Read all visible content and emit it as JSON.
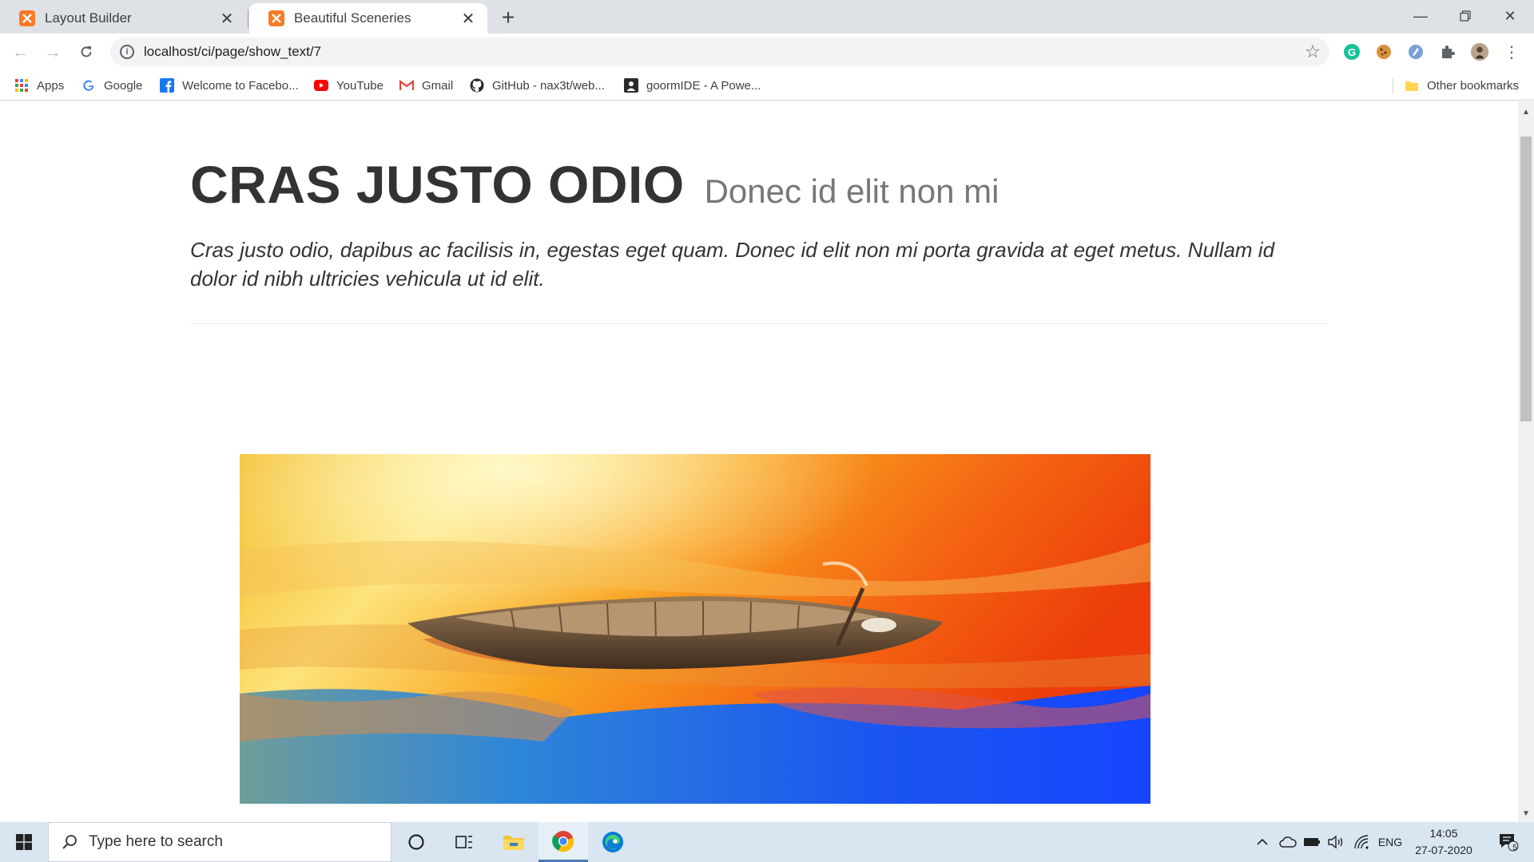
{
  "browser": {
    "tabs": [
      {
        "title": "Layout Builder",
        "active": false
      },
      {
        "title": "Beautiful Sceneries",
        "active": true
      }
    ],
    "url": "localhost/ci/page/show_text/7",
    "bookmarks": [
      {
        "label": "Apps",
        "icon": "apps-grid-icon"
      },
      {
        "label": "Google",
        "icon": "google-icon"
      },
      {
        "label": "Welcome to Facebo...",
        "icon": "facebook-icon"
      },
      {
        "label": "YouTube",
        "icon": "youtube-icon"
      },
      {
        "label": "Gmail",
        "icon": "gmail-icon"
      },
      {
        "label": "GitHub - nax3t/web...",
        "icon": "github-icon"
      },
      {
        "label": "goormIDE - A Powe...",
        "icon": "goorm-icon"
      }
    ],
    "other_bookmarks": "Other bookmarks"
  },
  "page": {
    "heading": "CRAS JUSTO ODIO",
    "subheading": "Donec id elit non mi",
    "lead": "Cras justo odio, dapibus ac facilisis in, egestas eget quam. Donec id elit non mi porta gravida at eget metus. Nullam id dolor id nibh ultricies vehicula ut id elit.",
    "image": "boat-on-colorful-water-sunset"
  },
  "taskbar": {
    "search_placeholder": "Type here to search",
    "language": "ENG",
    "time": "14:05",
    "date": "27-07-2020",
    "notification_count": "5"
  },
  "colors": {
    "accent": "#fb7a24",
    "taskbar": "#d9e6f2"
  }
}
